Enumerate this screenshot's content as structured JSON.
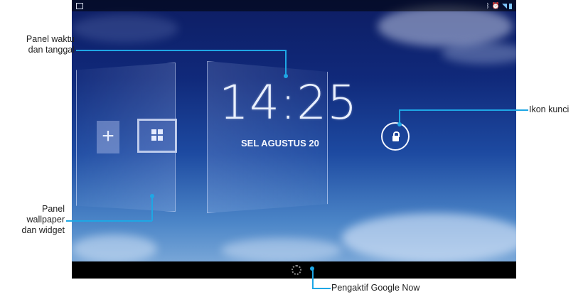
{
  "status_bar": {
    "icons": [
      "screenshot-icon",
      "bluetooth-icon",
      "alarm-icon",
      "wifi-icon",
      "battery-icon"
    ]
  },
  "lock_screen": {
    "time": "14:25",
    "date": "SEL AGUSTUS 20",
    "add_widget_symbol": "+"
  },
  "callouts": {
    "time_date_panel": "Panel waktu\ndan tanggal",
    "lock_icon": "Ikon kunci",
    "wallpaper_widget_panel": "Panel\nwallpaper\ndan widget",
    "google_now": "Pengaktif Google Now"
  },
  "colors": {
    "callout_line": "#1ea7e5",
    "sky_top": "#0d1d63",
    "sky_bottom": "#8bb4de"
  }
}
